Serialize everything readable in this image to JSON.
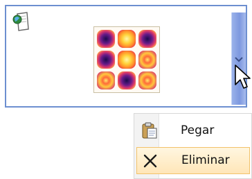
{
  "panel": {
    "icons": {
      "corner": "document-globe-icon",
      "thumbnail": "image-thumbnail-icon",
      "scroll": "chevron-down-icon",
      "cursor": "mouse-pointer-icon"
    }
  },
  "context_menu": {
    "items": [
      {
        "label": "Pegar",
        "icon": "paste-icon"
      },
      {
        "label": "Eliminar",
        "icon": "delete-x-icon"
      }
    ]
  },
  "colors": {
    "panel_border": "#6d8fd0",
    "scroll_handle": "#7d98df",
    "menu_highlight": "#ffe6b8",
    "menu_highlight_border": "#f2c26a"
  }
}
